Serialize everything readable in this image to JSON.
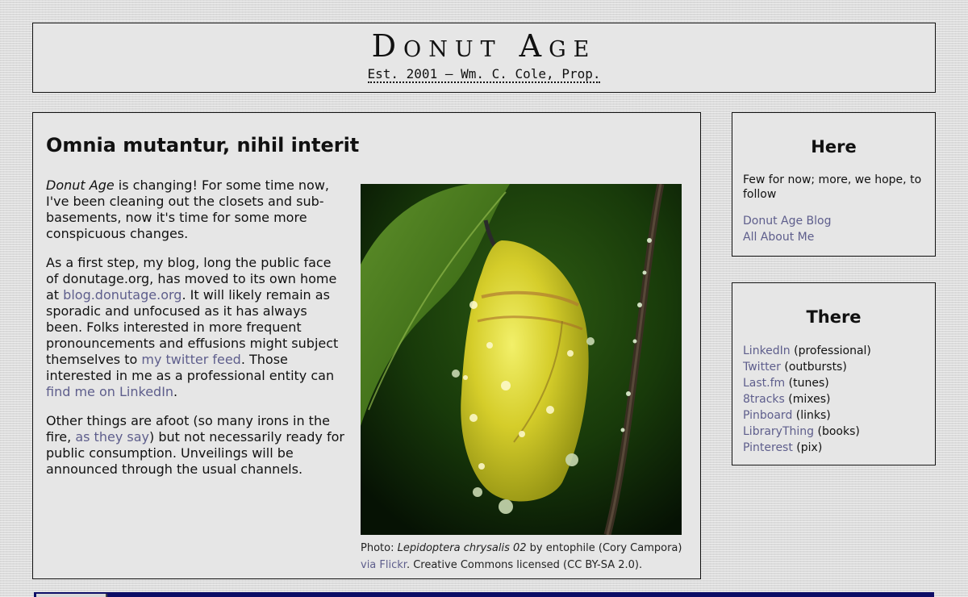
{
  "masthead": {
    "title": "Donut Age",
    "subtitle": "Est. 2001 — Wm. C. Cole, Prop."
  },
  "post": {
    "title": "Omnia mutantur, nihil interit",
    "p1": {
      "em": "Donut Age",
      "text": " is changing! For some time now, I've been cleaning out the closets and sub-basements, now it's time for some more conspicuous changes."
    },
    "p2": {
      "t1": "As a first step, my blog, long the public face of donutage.org, has moved to its own home at ",
      "link1": "blog.donutage.org",
      "t2": ". It will likely remain as sporadic and unfocused as it has always been. Folks interested in more frequent pronouncements and effusions might subject themselves to ",
      "link2": "my twitter feed",
      "t3": ". Those interested in me as a professional entity can ",
      "link3": "find me on LinkedIn",
      "t4": "."
    },
    "p3": {
      "t1": "Other things are afoot (so many irons in the fire, ",
      "link1": "as they say",
      "t2": ") but not necessarily ready for public consumption. Unveilings will be announced through the usual channels."
    }
  },
  "figure": {
    "caption_prefix": "Photo: ",
    "caption_title": "Lepidoptera chrysalis 02",
    "caption_mid": " by entophile (Cory Campora) ",
    "caption_link": "via Flickr",
    "caption_suffix": ". Creative Commons licensed (CC BY-SA 2.0)."
  },
  "sidebar": {
    "here": {
      "title": "Here",
      "text": "Few for now; more, we hope, to follow",
      "links": [
        "Donut Age Blog",
        "All About Me"
      ]
    },
    "there": {
      "title": "There",
      "links": [
        {
          "label": "LinkedIn",
          "note": " (professional)"
        },
        {
          "label": "Twitter",
          "note": " (outbursts)"
        },
        {
          "label": "Last.fm",
          "note": " (tunes)"
        },
        {
          "label": "8tracks",
          "note": " (mixes)"
        },
        {
          "label": "Pinboard",
          "note": " (links)"
        },
        {
          "label": "LibraryThing",
          "note": " (books)"
        },
        {
          "label": "Pinterest",
          "note": " (pix)"
        }
      ]
    }
  },
  "colors": {
    "link": "#5e5e8c",
    "panel": "#e6e6e6",
    "border": "#111111",
    "bottom_bar": "#0d0d66"
  }
}
